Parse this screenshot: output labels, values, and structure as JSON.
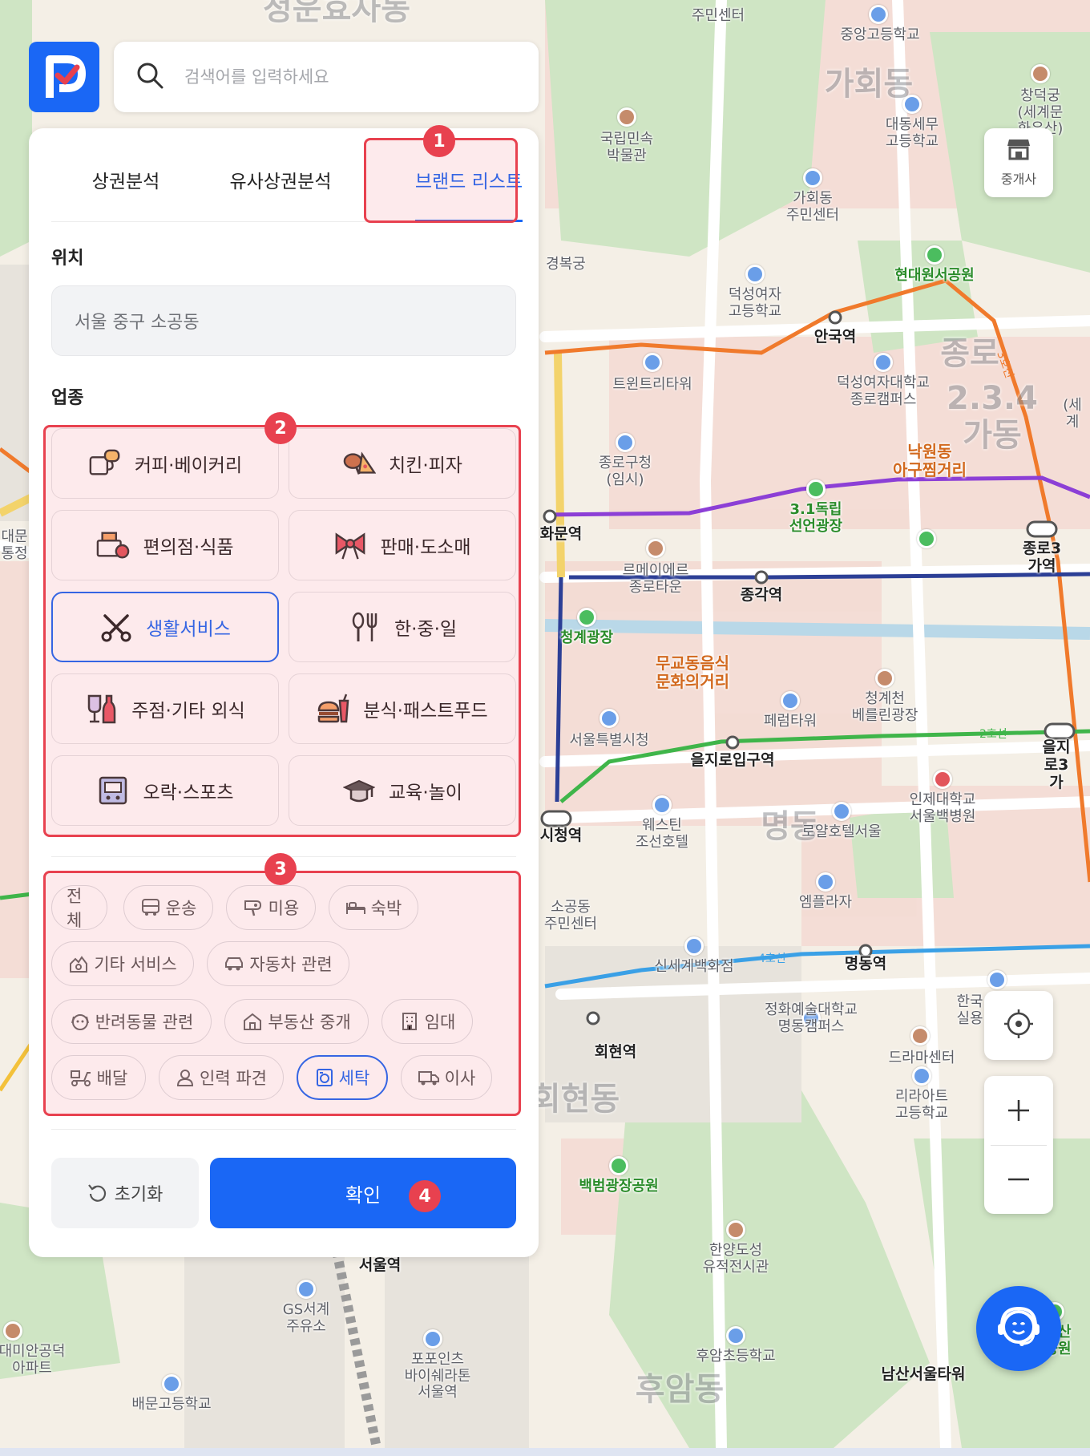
{
  "search": {
    "placeholder": "검색어를 입력하세요"
  },
  "tabs": [
    {
      "label": "상권분석",
      "active": false
    },
    {
      "label": "유사상권분석",
      "active": false
    },
    {
      "label": "브랜드 리스트",
      "active": true
    }
  ],
  "location": {
    "title": "위치",
    "value": "서울 중구 소공동"
  },
  "industry": {
    "title": "업종",
    "categories": [
      {
        "label": "커피·베이커리",
        "icon": "coffee-bakery-icon",
        "active": false
      },
      {
        "label": "치킨·피자",
        "icon": "chicken-pizza-icon",
        "active": false
      },
      {
        "label": "편의점·식품",
        "icon": "convenience-store-icon",
        "active": false
      },
      {
        "label": "판매·도소매",
        "icon": "ribbon-gift-icon",
        "active": false
      },
      {
        "label": "생활서비스",
        "icon": "scissors-tools-icon",
        "active": true
      },
      {
        "label": "한·중·일",
        "icon": "spoon-fork-icon",
        "active": false
      },
      {
        "label": "주점·기타 외식",
        "icon": "drinks-icon",
        "active": false
      },
      {
        "label": "분식·패스트푸드",
        "icon": "burger-icon",
        "active": false
      },
      {
        "label": "오락·스포츠",
        "icon": "arcade-icon",
        "active": false
      },
      {
        "label": "교육·놀이",
        "icon": "graduation-cap-icon",
        "active": false
      }
    ],
    "subcategories": [
      {
        "label": "전체",
        "icon": "",
        "active": false
      },
      {
        "label": "운송",
        "icon": "bus-icon",
        "active": false
      },
      {
        "label": "미용",
        "icon": "hair-dryer-icon",
        "active": false
      },
      {
        "label": "숙박",
        "icon": "bed-icon",
        "active": false
      },
      {
        "label": "기타 서비스",
        "icon": "service-icon",
        "active": false
      },
      {
        "label": "자동차 관련",
        "icon": "car-icon",
        "active": false
      },
      {
        "label": "반려동물 관련",
        "icon": "pet-icon",
        "active": false
      },
      {
        "label": "부동산 중개",
        "icon": "house-icon",
        "active": false
      },
      {
        "label": "임대",
        "icon": "building-icon",
        "active": false
      },
      {
        "label": "배달",
        "icon": "scooter-icon",
        "active": false
      },
      {
        "label": "인력 파견",
        "icon": "person-icon",
        "active": false
      },
      {
        "label": "세탁",
        "icon": "washing-machine-icon",
        "active": true
      },
      {
        "label": "이사",
        "icon": "truck-icon",
        "active": false
      }
    ]
  },
  "actions": {
    "reset": "초기화",
    "confirm": "확인"
  },
  "markers": [
    "1",
    "2",
    "3",
    "4"
  ],
  "map_controls": {
    "realtor": "중개사"
  },
  "map_labels": [
    "청운효자동",
    "주민센터",
    "중앙고등학교",
    "가회동",
    "창덕궁\n(세계문화유산)",
    "국립민속\n박물관",
    "대동세무\n고등학교",
    "가회동\n주민센터",
    "경복궁",
    "현대원서공원",
    "덕성여자\n고등학교",
    "안국역",
    "종로",
    "트윈트리타워",
    "덕성여자대학교\n종로캠퍼스",
    "2.3.4가동",
    "(세계",
    "종로구청\n(임시)",
    "낙원동\n아구찜거리",
    "3.1독립\n선언광장",
    "화문역",
    "종로3가역",
    "르메이에르\n종로타운",
    "종각역",
    "청계광장",
    "무교동음식\n문화의거리",
    "청계천\n베를린광장",
    "페럼타워",
    "서울특별시청",
    "을지로입구역",
    "을지로3가",
    "시청역",
    "웨스틴\n조선호텔",
    "인제대학교\n서울백병원",
    "명동",
    "로얄호텔서울",
    "소공동\n주민센터",
    "엠플라자",
    "신세계백화점",
    "명동역",
    "정화예술대학교\n명동캠퍼스",
    "한국\n실용",
    "회현역",
    "드라마센터",
    "회현동",
    "리라아트\n고등학교",
    "백범광장공원",
    "서울역",
    "한양도성\n유적전시관",
    "GS서계\n주유소",
    "포포인츠\n바이쉐라톤\n서울역",
    "후암초등학교",
    "후암동",
    "남산서울타워",
    "배문고등학교",
    "대미안공덕\n아파트",
    "대문\n통정",
    "남산공원",
    "2호선",
    "3호선",
    "4호선"
  ]
}
